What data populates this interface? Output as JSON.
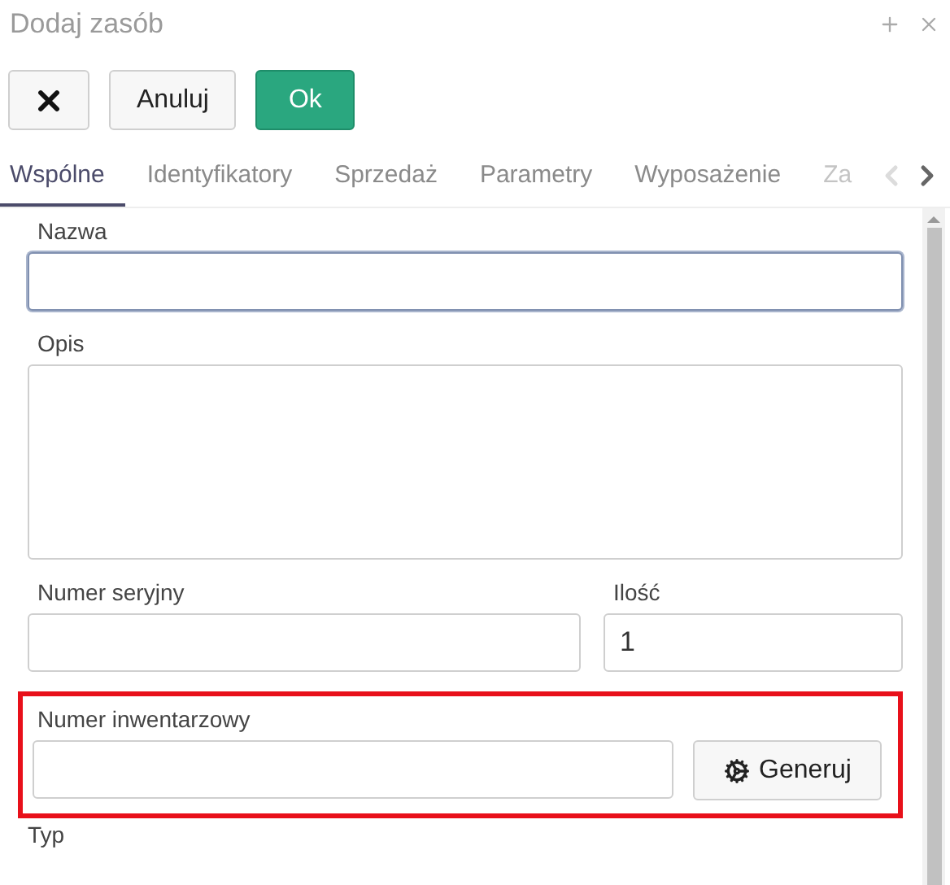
{
  "window": {
    "title": "Dodaj zasób"
  },
  "toolbar": [
    {
      "kind": "close"
    },
    {
      "kind": "default",
      "label": "Anuluj"
    },
    {
      "kind": "primary",
      "label": "Ok"
    }
  ],
  "tabs": [
    {
      "label": "Wspólne",
      "selected": true
    },
    {
      "label": "Identyfikatory",
      "selected": false
    },
    {
      "label": "Sprzedaż",
      "selected": false
    },
    {
      "label": "Parametry",
      "selected": false
    },
    {
      "label": "Wyposażenie",
      "selected": false
    },
    {
      "label": "Za",
      "selected": false
    }
  ],
  "tab_scroll": {
    "left_disabled": true,
    "right_disabled": false
  },
  "form": {
    "name": {
      "label": "Nazwa",
      "focused": true
    },
    "description": {
      "label": "Opis"
    },
    "serial": {
      "label": "Numer seryjny"
    },
    "quantity": {
      "label": "Ilość",
      "value": "1"
    },
    "inventory": {
      "label": "Numer inwentarzowy",
      "highlighted": true,
      "button": "Generuj"
    },
    "type": {
      "label": "Typ"
    }
  }
}
